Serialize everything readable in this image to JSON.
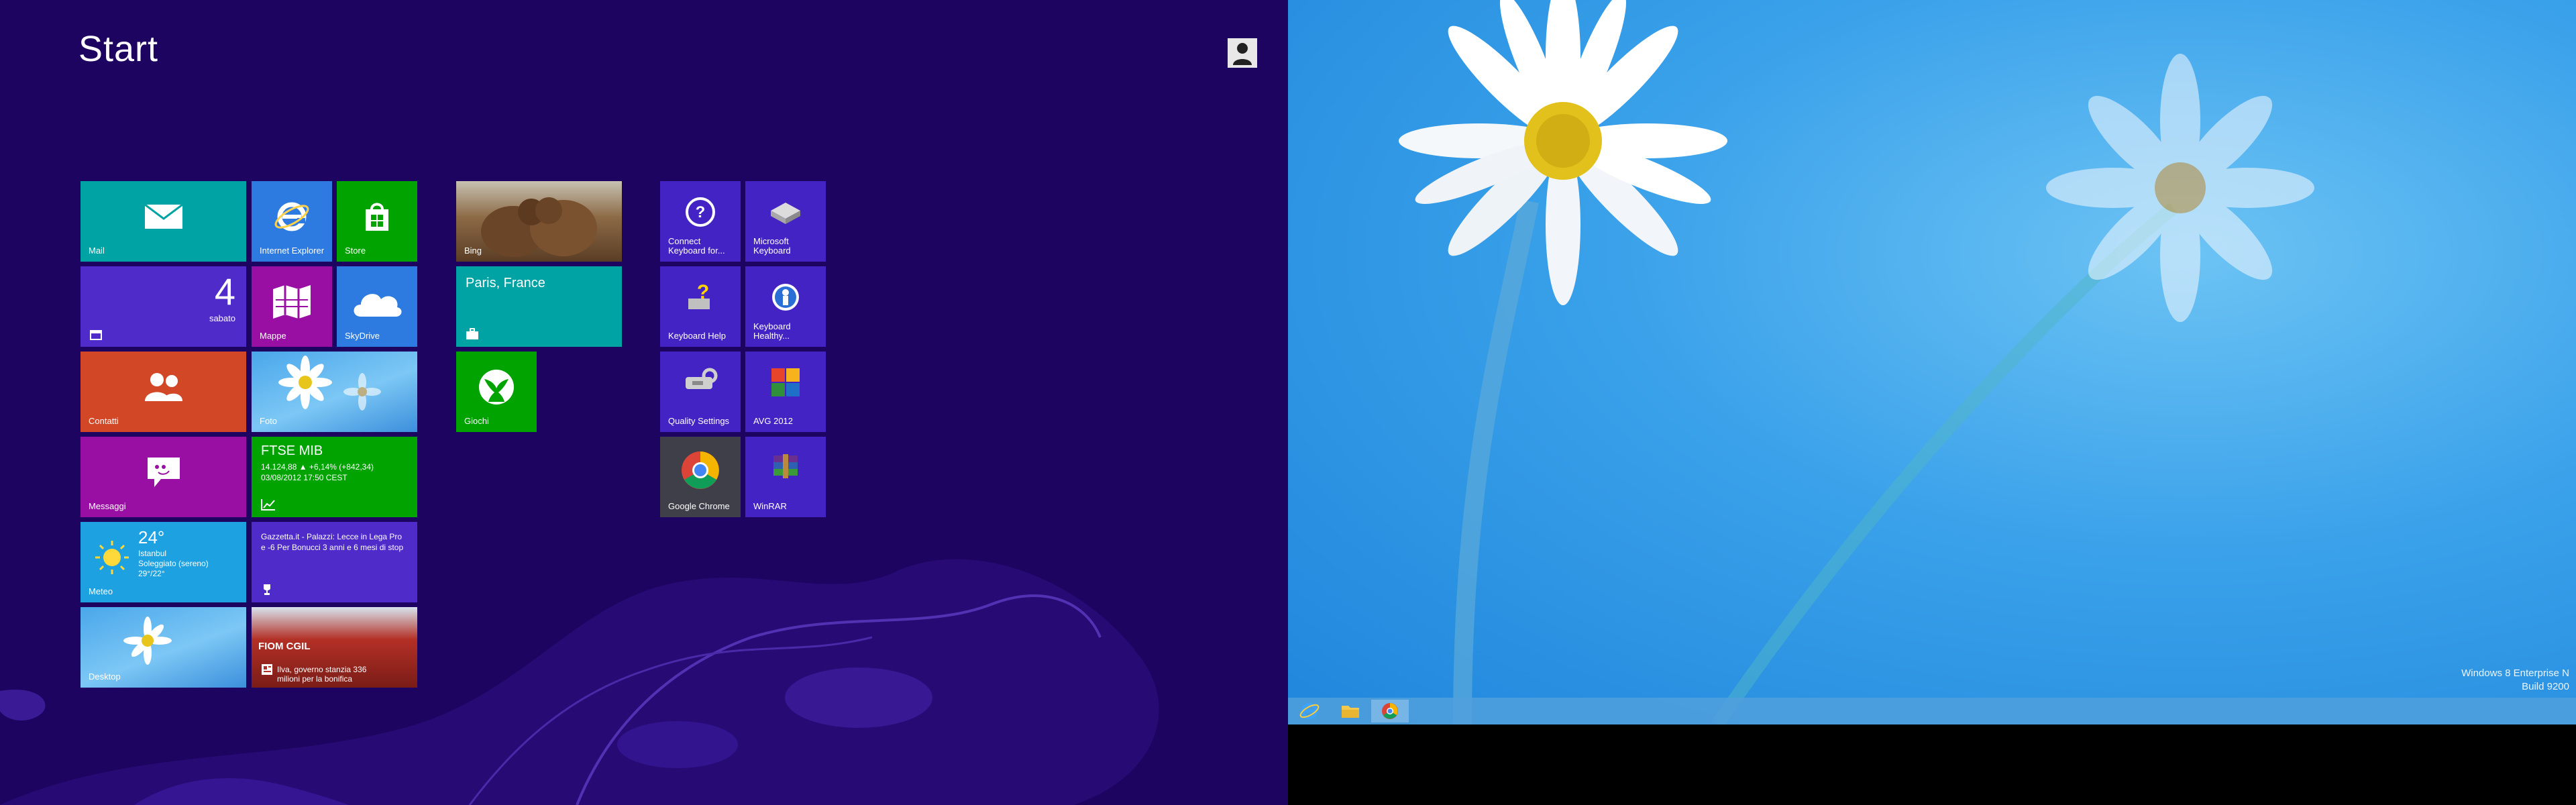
{
  "start": {
    "title": "Start",
    "user_icon": "user-icon",
    "tiles": {
      "mail": {
        "label": "Mail",
        "icon": "mail-icon"
      },
      "ie": {
        "label": "Internet Explorer",
        "icon": "internet-explorer-icon"
      },
      "store": {
        "label": "Store",
        "icon": "store-icon"
      },
      "calendar": {
        "day": "4",
        "weekday": "sabato",
        "icon": "calendar-icon"
      },
      "maps": {
        "label": "Mappe",
        "icon": "maps-icon"
      },
      "skydrive": {
        "label": "SkyDrive",
        "icon": "cloud-icon"
      },
      "contacts": {
        "label": "Contatti",
        "icon": "people-icon"
      },
      "photos": {
        "label": "Foto"
      },
      "messaging": {
        "label": "Messaggi",
        "icon": "message-icon"
      },
      "finance": {
        "title": "FTSE MIB",
        "line1": "14.124,88 ▲ +6,14% (+842,34)",
        "line2": "03/08/2012 17:50 CEST",
        "icon": "chart-icon"
      },
      "weather": {
        "temp": "24°",
        "city": "Istanbul",
        "cond": "Soleggiato (sereno)",
        "range": "29°/22°",
        "label": "Meteo",
        "icon": "sun-icon"
      },
      "sport": {
        "text": "Gazzetta.it - Palazzi: Lecce in Lega Pro e -6 Per Bonucci 3 anni e 6 mesi di stop",
        "icon": "trophy-icon"
      },
      "desktop": {
        "label": "Desktop"
      },
      "news": {
        "text": "Ilva, governo stanzia 336 milioni per la bonifica",
        "sign": "FIOM CGIL",
        "icon": "news-icon"
      },
      "bing": {
        "label": "Bing"
      },
      "travel": {
        "text": "Paris, France",
        "icon": "luggage-icon"
      },
      "games": {
        "label": "Giochi",
        "icon": "xbox-icon"
      },
      "connect_kb": {
        "label": "Connect Keyboard for...",
        "icon": "help-icon"
      },
      "ms_kb": {
        "label": "Microsoft Keyboard",
        "icon": "keyboard-icon"
      },
      "kb_help": {
        "label": "Keyboard Help",
        "icon": "keyboard-help-icon"
      },
      "kb_healthy": {
        "label": "Keyboard Healthy...",
        "icon": "health-icon"
      },
      "quality": {
        "label": "Quality Settings",
        "icon": "settings-icon"
      },
      "avg": {
        "label": "AVG 2012",
        "icon": "avg-icon"
      },
      "chrome": {
        "label": "Google Chrome",
        "icon": "chrome-icon"
      },
      "winrar": {
        "label": "WinRAR",
        "icon": "winrar-icon"
      }
    }
  },
  "desktop": {
    "watermark_line1": "Windows 8 Enterprise N",
    "watermark_line2": "Build 9200",
    "taskbar": [
      "internet-explorer-icon",
      "file-explorer-icon",
      "chrome-icon"
    ]
  }
}
